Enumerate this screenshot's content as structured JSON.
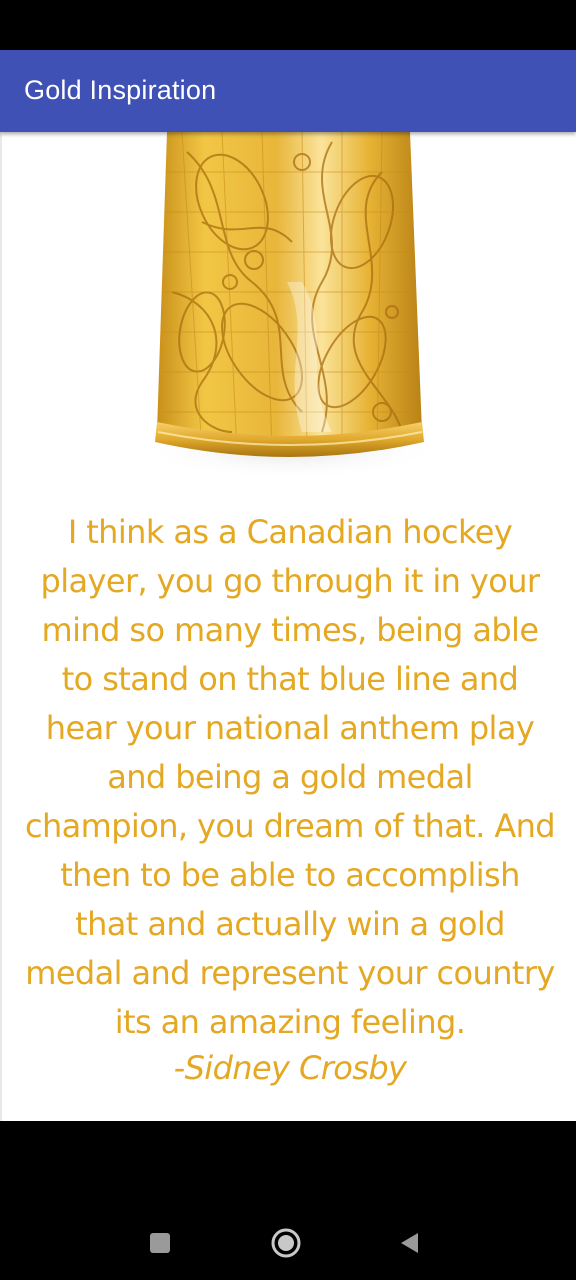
{
  "app_bar": {
    "title": "Gold Inspiration",
    "color": "#3F51B5"
  },
  "quote": {
    "lines": [
      "I think as a Canadian hockey",
      "player, you go through it in your",
      "mind so many times, being able",
      "to stand on that blue line and",
      "hear your national anthem play",
      "and being a gold medal",
      "champion, you dream of that. And",
      "then to be able to accomplish",
      "that and actually win a gold",
      "medal and represent your country",
      "its an amazing feeling."
    ],
    "author": "-Sidney Crosby",
    "text_color": "#E4A822"
  },
  "image": {
    "subject": "gold-filigree-cuff-bracelet"
  },
  "nav": {
    "recents_icon": "square-icon",
    "home_icon": "circle-icon",
    "back_icon": "triangle-icon"
  }
}
